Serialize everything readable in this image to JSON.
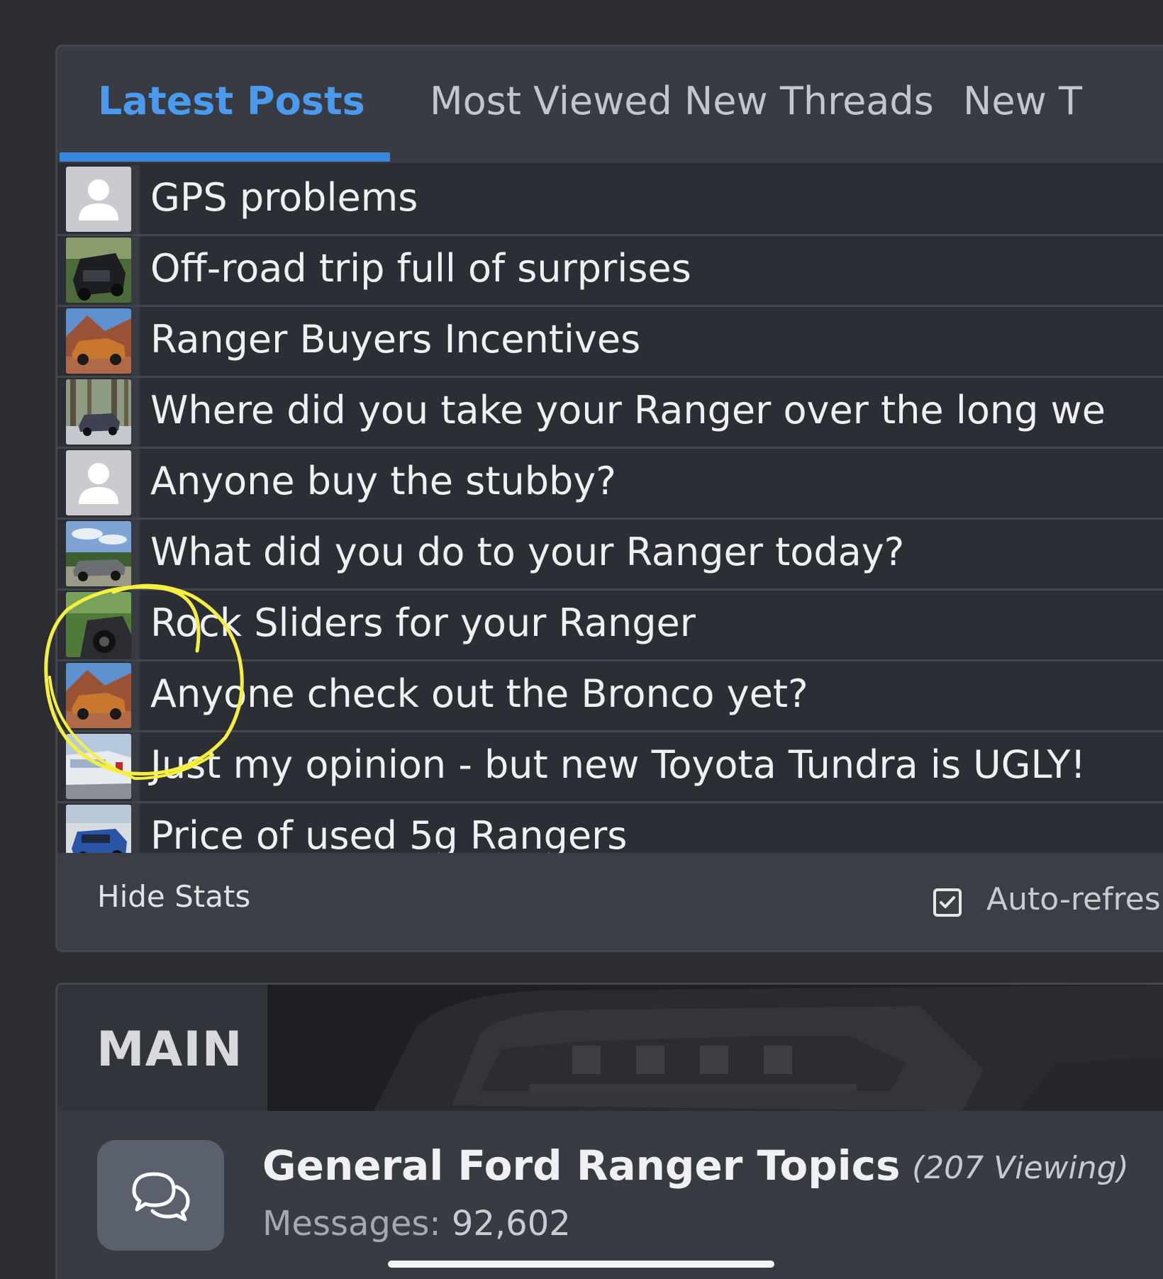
{
  "tabs": [
    {
      "label": "Latest Posts",
      "active": true
    },
    {
      "label": "Most Viewed New Threads",
      "active": false
    },
    {
      "label": "New T",
      "active": false
    }
  ],
  "posts": [
    {
      "title": "GPS problems",
      "avatar": "default-user-avatar"
    },
    {
      "title": "Off-road trip full of surprises",
      "avatar": "truck-photo-avatar"
    },
    {
      "title": "Ranger Buyers Incentives",
      "avatar": "orange-ranger-avatar"
    },
    {
      "title": "Where did you take your Ranger over the long we",
      "avatar": "forest-truck-avatar"
    },
    {
      "title": "Anyone buy the stubby?",
      "avatar": "default-user-avatar"
    },
    {
      "title": "What did you do to your Ranger today?",
      "avatar": "sky-truck-avatar"
    },
    {
      "title": "Rock Sliders for your Ranger",
      "avatar": "green-trail-avatar"
    },
    {
      "title": "Anyone check out the Bronco yet?",
      "avatar": "orange-ranger-avatar"
    },
    {
      "title": "Just my opinion - but new Toyota Tundra is UGLY!",
      "avatar": "white-truck-avatar"
    },
    {
      "title": "Price of used 5g Rangers",
      "avatar": "blue-truck-avatar"
    }
  ],
  "footer": {
    "hide_stats": "Hide Stats",
    "auto_refresh": "Auto-refres",
    "auto_refresh_checked": true
  },
  "main": {
    "title": "MAIN",
    "forum": {
      "title": "General Ford Ranger Topics",
      "viewing": "(207 Viewing)",
      "messages_label": "Messages:",
      "messages_value": "92,602",
      "icon": "chat-bubbles-icon"
    }
  },
  "colors": {
    "accent": "#3a87e0",
    "annotation": "#f5f040",
    "background": "#2b2d33"
  }
}
